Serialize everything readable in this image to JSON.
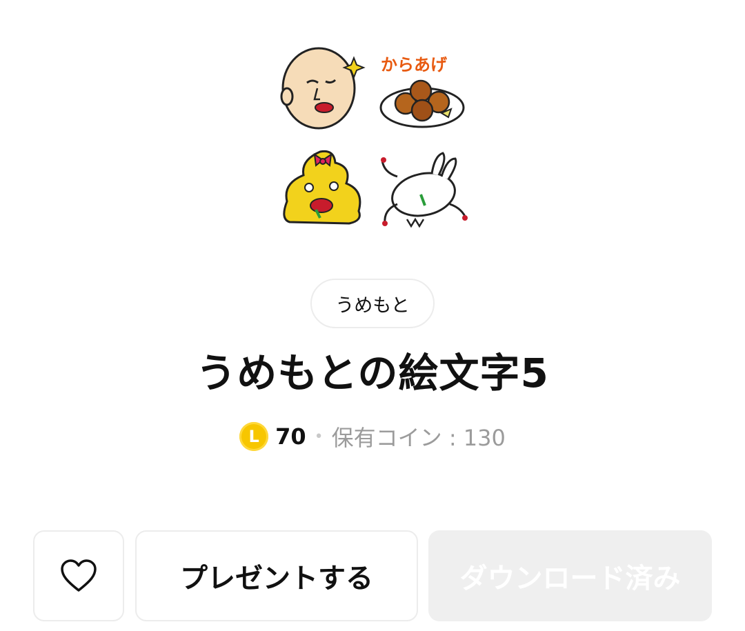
{
  "author": {
    "name": "うめもと"
  },
  "product": {
    "title": "うめもとの絵文字5"
  },
  "price": {
    "coin_symbol": "L",
    "amount": "70",
    "separator": "•",
    "owned_label": "保有コイン : 130"
  },
  "actions": {
    "present_label": "プレゼントする",
    "download_label": "ダウンロード済み"
  },
  "preview": {
    "stickers": [
      "bald-face-sticker",
      "karaage-sticker",
      "poop-with-bow-sticker",
      "rabbit-sticker"
    ],
    "karaage_text": "からあげ"
  },
  "colors": {
    "coin": "#f7c600",
    "download_bg": "#efefef",
    "border": "#ececec"
  }
}
